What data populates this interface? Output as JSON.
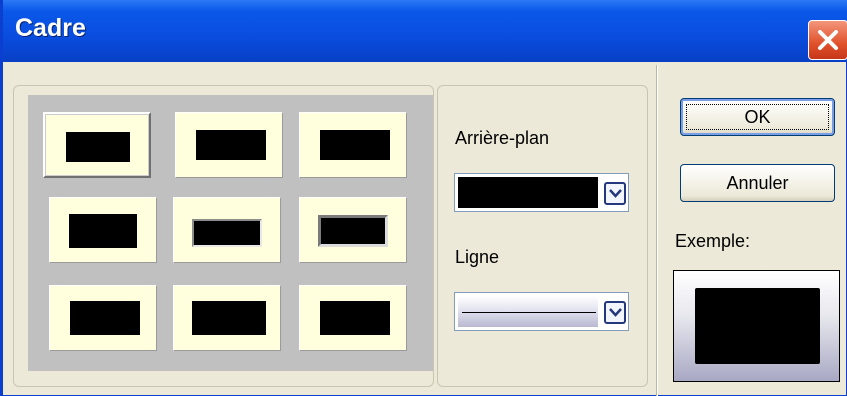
{
  "window": {
    "title": "Cadre"
  },
  "frame_grid": {
    "selected_index": 0,
    "cells": [
      {
        "id": 1
      },
      {
        "id": 2
      },
      {
        "id": 3
      },
      {
        "id": 4
      },
      {
        "id": 5
      },
      {
        "id": 6
      },
      {
        "id": 7
      },
      {
        "id": 8
      },
      {
        "id": 9
      }
    ]
  },
  "background": {
    "label": "Arrière-plan",
    "value_color": "#000000"
  },
  "line": {
    "label": "Ligne",
    "value": "solid"
  },
  "buttons": {
    "ok": "OK",
    "cancel": "Annuler"
  },
  "preview": {
    "label": "Exemple:"
  },
  "colors": {
    "titlebar": "#0a4ee0",
    "cell_bg": "#ffffdd",
    "grid_bg": "#c0c0c0"
  }
}
